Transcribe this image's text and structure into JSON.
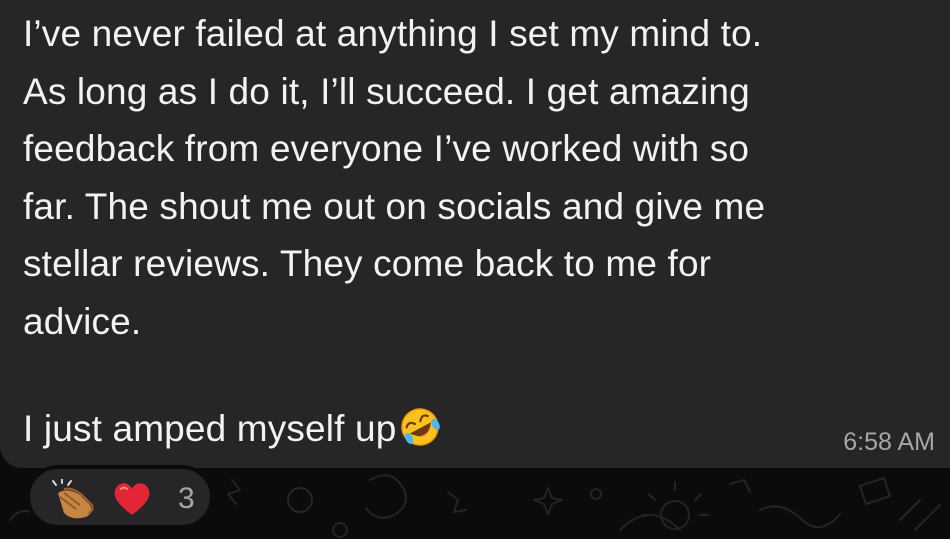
{
  "message": {
    "text": "I’ve never failed at anything I set my mind to.\nAs long as I do it, I’ll succeed. I get amazing\nfeedback from everyone I’ve worked with so\nfar. The shout me out on socials and give me\nstellar reviews. They come back to me for\nadvice.",
    "last_line": "I just amped myself up",
    "emoji": "rolling-on-the-floor-laughing-icon",
    "timestamp": "6:58 AM"
  },
  "reactions": {
    "items": [
      {
        "name": "clapping-hands-icon"
      },
      {
        "name": "red-heart-icon"
      }
    ],
    "count": "3"
  },
  "colors": {
    "bubble": "#262628",
    "background": "#0b0b0b",
    "text": "#f2f2f2",
    "meta": "#a6a6aa",
    "heart": "#e32636"
  }
}
